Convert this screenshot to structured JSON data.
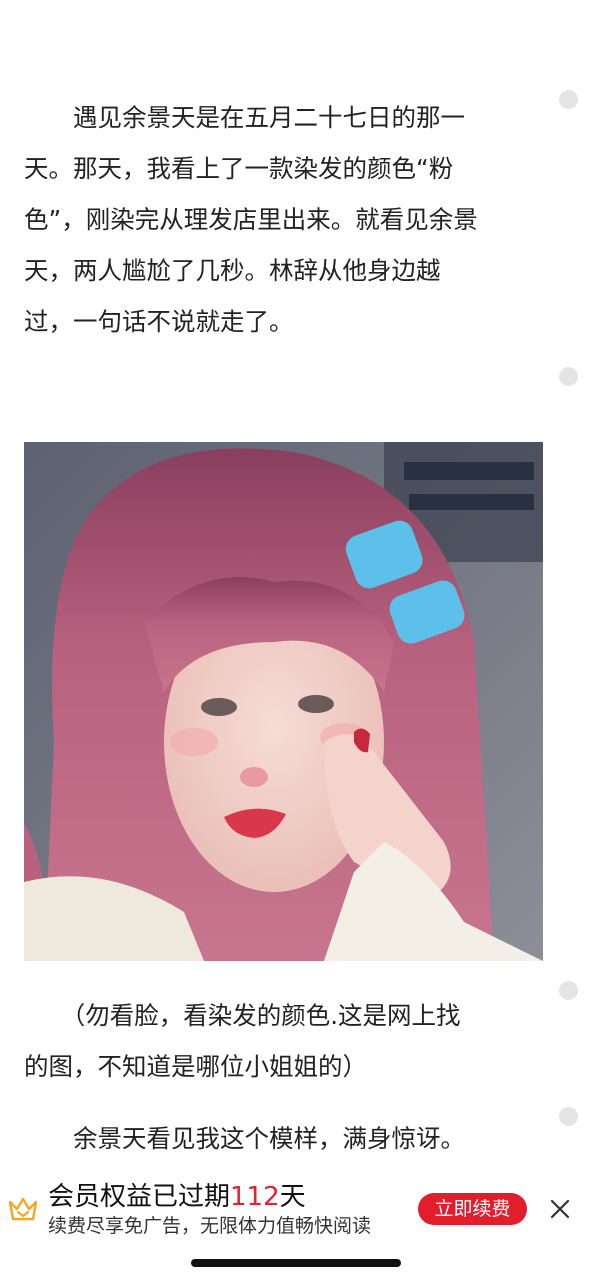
{
  "article": {
    "paragraph1": "　　遇见余景天是在五月二十七日的那一\n天。那天，我看上了一款染发的颜色“粉\n色”，刚染完从理发店里出来。就看见余景\n天，两人尴尬了几秒。林辞从他身边越\n过，一句话不说就走了。",
    "caption": "　　（勿看脸，看染发的颜色.这是网上找\n的图，不知道是哪位小姐姐的）",
    "paragraph2": "　　余景天看见我这个模样，满身惊讶。"
  },
  "vip_banner": {
    "title_prefix": "会员权益已过期",
    "days": "112",
    "title_suffix": "天",
    "subtitle": "续费尽享免广告，无限体力值畅快阅读",
    "renew_label": "立即续费",
    "accent_color": "#e21e2c",
    "crown_color": "#f5a623",
    "icons": [
      "crown-icon",
      "close-icon"
    ]
  },
  "colors": {
    "text": "#222222",
    "hair": "#b5617e",
    "hair_clip": "#5cc0ea"
  }
}
